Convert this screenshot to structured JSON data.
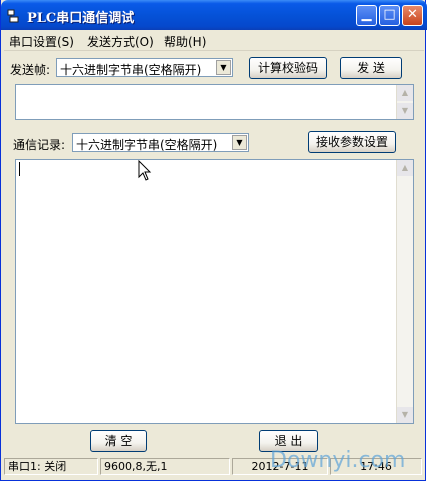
{
  "window": {
    "title": "PLC串口通信调试"
  },
  "menu": {
    "items": [
      "串口设置(S)",
      "发送方式(O)",
      "帮助(H)"
    ]
  },
  "send": {
    "label": "发送帧:",
    "format": "十六进制字节串(空格隔开)",
    "checksum_button": "计算校验码",
    "send_button": "发 送",
    "value": ""
  },
  "log": {
    "label": "通信记录:",
    "format": "十六进制字节串(空格隔开)",
    "recv_settings_button": "接收参数设置",
    "value": ""
  },
  "actions": {
    "clear_button": "清 空",
    "exit_button": "退 出"
  },
  "status": {
    "port": "串口1: 关闭",
    "params": "9600,8,无,1",
    "date": "2012-7-11",
    "time": "17:46"
  },
  "watermark": "Downyi.com",
  "icons": {
    "app": "plc-app-icon",
    "minimize": "minimize-icon",
    "maximize": "maximize-icon",
    "close": "close-icon",
    "dropdown": "chevron-down-icon",
    "scroll_up": "scroll-up-icon",
    "scroll_down": "scroll-down-icon"
  }
}
